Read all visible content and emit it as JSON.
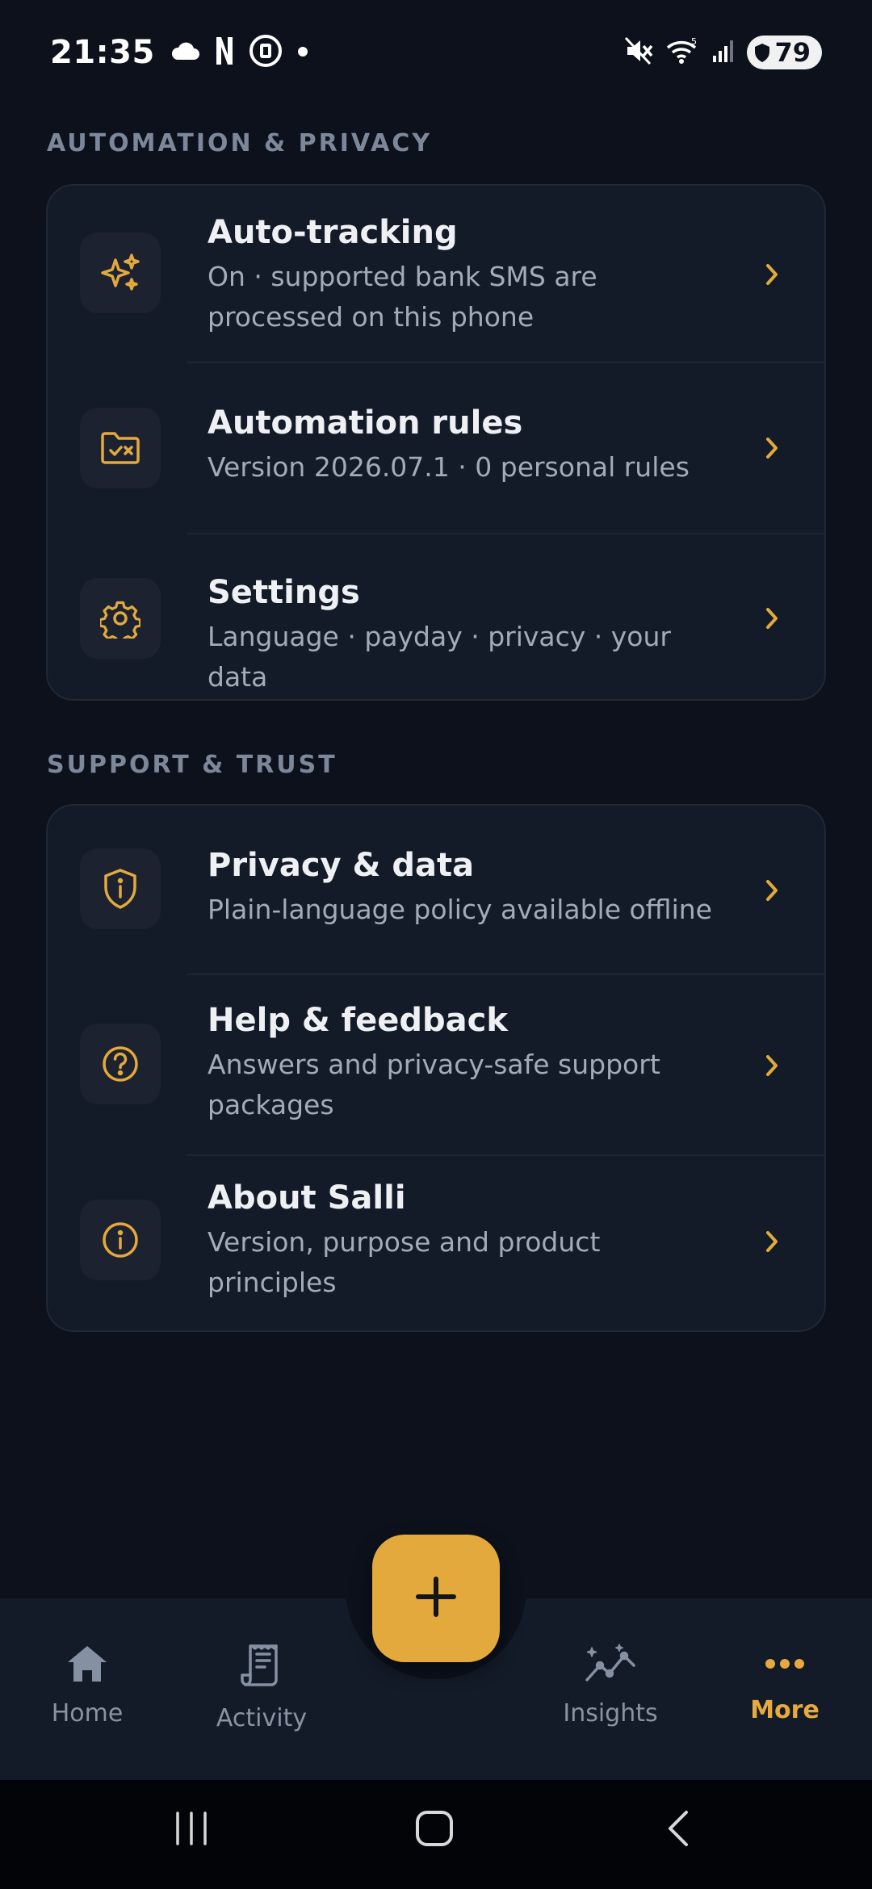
{
  "status_bar": {
    "time": "21:35",
    "battery": "79"
  },
  "sections": {
    "automation": {
      "header": "AUTOMATION & PRIVACY",
      "items": [
        {
          "title": "Auto-tracking",
          "subtitle": "On · supported bank SMS are processed on this phone",
          "icon": "sparkles-icon"
        },
        {
          "title": "Automation rules",
          "subtitle": "Version 2026.07.1 · 0 personal rules",
          "icon": "folder-rules-icon"
        },
        {
          "title": "Settings",
          "subtitle": "Language · payday · privacy · your data",
          "icon": "gear-icon"
        }
      ]
    },
    "support": {
      "header": "SUPPORT & TRUST",
      "items": [
        {
          "title": "Privacy & data",
          "subtitle": "Plain-language policy available offline",
          "icon": "shield-info-icon"
        },
        {
          "title": "Help & feedback",
          "subtitle": "Answers and privacy-safe support packages",
          "icon": "question-circle-icon"
        },
        {
          "title": "About Salli",
          "subtitle": "Version, purpose and product principles",
          "icon": "info-circle-icon"
        }
      ]
    }
  },
  "bottom_nav": {
    "items": [
      {
        "label": "Home",
        "icon": "home-icon"
      },
      {
        "label": "Activity",
        "icon": "receipt-icon"
      },
      {
        "label": "Insights",
        "icon": "insights-chart-icon"
      },
      {
        "label": "More",
        "icon": "more-dots-icon",
        "active": true
      }
    ],
    "fab_icon": "plus-icon"
  },
  "colors": {
    "background": "#0c111c",
    "card": "#131b28",
    "accent": "#e3a93d",
    "muted_text": "#a3abb8"
  }
}
